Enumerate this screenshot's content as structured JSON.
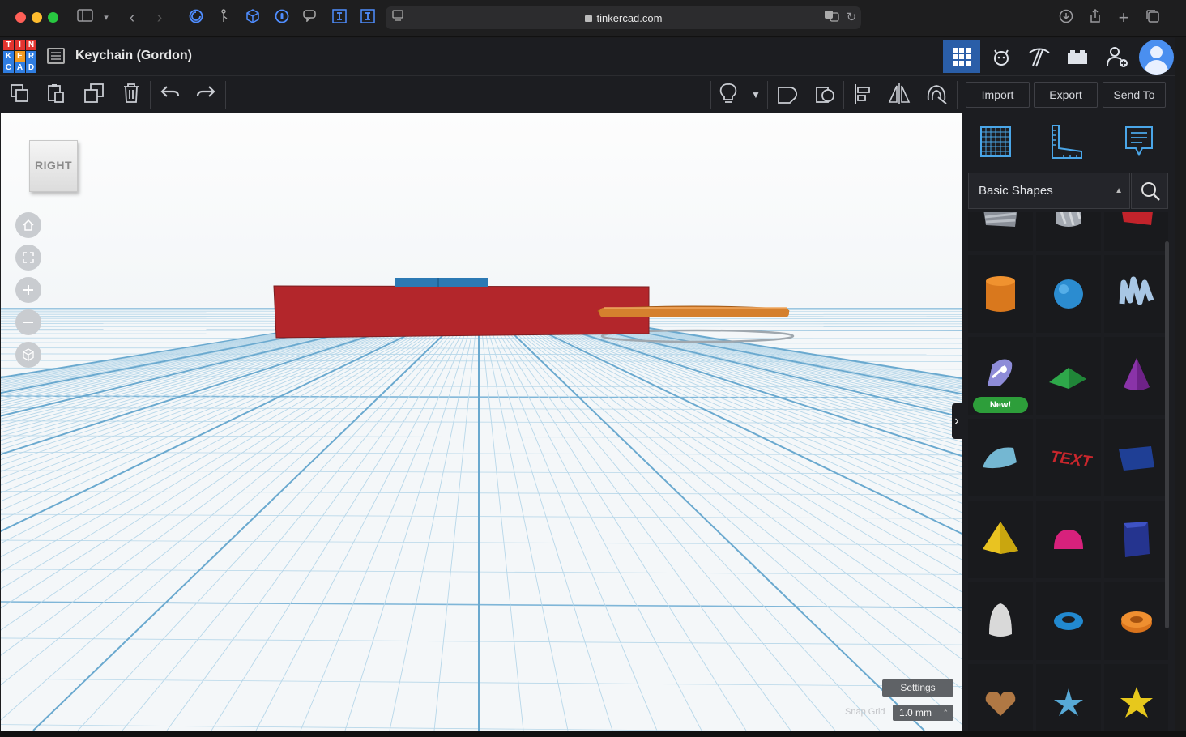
{
  "browser": {
    "url": "tinkercad.com"
  },
  "app": {
    "logo_letters": [
      "T",
      "I",
      "N",
      "K",
      "E",
      "R",
      "C",
      "A",
      "D"
    ],
    "logo_colors": [
      "#e3342f",
      "#e3342f",
      "#e3342f",
      "#2f7de1",
      "#f29a1f",
      "#2f7de1",
      "#2f7de1",
      "#2f7de1",
      "#2f7de1"
    ],
    "design_title": "Keychain (Gordon)",
    "view_modes": [
      {
        "name": "3d-design",
        "icon": "grid-icon",
        "active": true
      },
      {
        "name": "codeblocks",
        "icon": "cat-icon",
        "active": false
      },
      {
        "name": "build",
        "icon": "pickaxe-icon",
        "active": false
      },
      {
        "name": "bricks",
        "icon": "brick-icon",
        "active": false
      },
      {
        "name": "invite",
        "icon": "add-user-icon",
        "active": false
      }
    ]
  },
  "toolbar": {
    "left_tools": [
      "copy-icon",
      "paste-icon",
      "duplicate-icon",
      "delete-icon",
      "undo-icon",
      "redo-icon"
    ],
    "right_tools": [
      "light-bulb-icon",
      "dropdown-caret-icon",
      "group-icon",
      "ungroup-icon",
      "align-icon",
      "mirror-icon",
      "cruise-icon"
    ],
    "import_label": "Import",
    "export_label": "Export",
    "send_to_label": "Send To"
  },
  "workplane": {
    "viewcube_label": "RIGHT",
    "nav_buttons": [
      "home-icon",
      "fit-view-icon",
      "zoom-in-icon",
      "zoom-out-icon",
      "perspective-icon"
    ],
    "settings_label": "Settings",
    "snap_grid_label": "Snap Grid",
    "snap_grid_value": "1.0 mm"
  },
  "panel": {
    "tools": [
      "workplane-icon",
      "ruler-icon",
      "notes-icon"
    ],
    "category": "Basic Shapes",
    "new_badge": "New!",
    "shapes": [
      "box-striped",
      "cylinder-striped",
      "box",
      "cylinder",
      "sphere",
      "scribble",
      "shape-generator",
      "roof",
      "cone",
      "round-roof",
      "text",
      "wedge",
      "pyramid",
      "half-sphere",
      "polygon",
      "paraboloid",
      "torus",
      "tube",
      "heart",
      "star",
      "star-yellow"
    ]
  }
}
